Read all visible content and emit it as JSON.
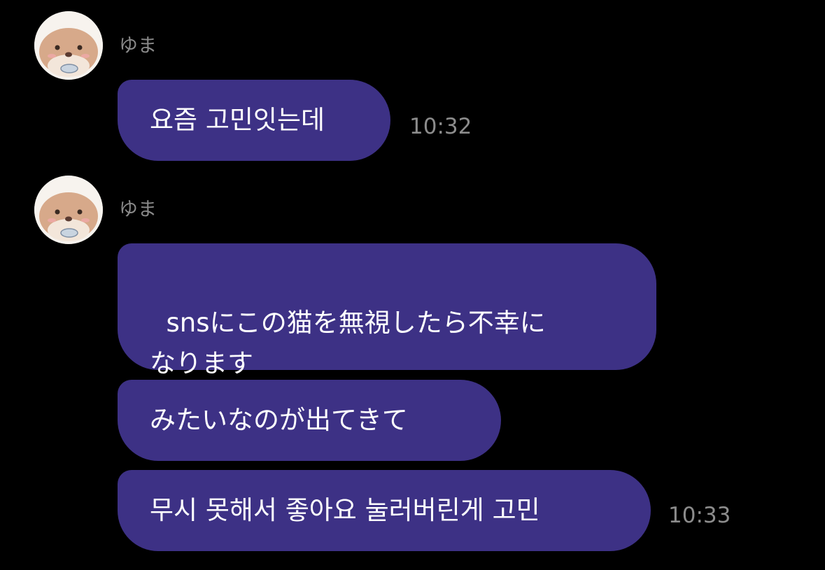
{
  "messages": [
    {
      "sender": "ゆま",
      "avatar": "otter-avatar-icon",
      "bubbles": [
        {
          "text": "요즘 고민잇는데",
          "time": "10:32"
        }
      ]
    },
    {
      "sender": "ゆま",
      "avatar": "otter-avatar-icon",
      "bubbles": [
        {
          "text": "snsにこの猫を無視したら不幸に\nなります"
        },
        {
          "text": "みたいなのが出てきて"
        },
        {
          "text": "무시 못해서 좋아요 눌러버린게 고민",
          "time": "10:33"
        }
      ]
    }
  ],
  "colors": {
    "background": "#000000",
    "bubble": "#3d3185",
    "bubble_text": "#ffffff",
    "sender_text": "#8a8a8a",
    "time_text": "#8c8c8c"
  }
}
